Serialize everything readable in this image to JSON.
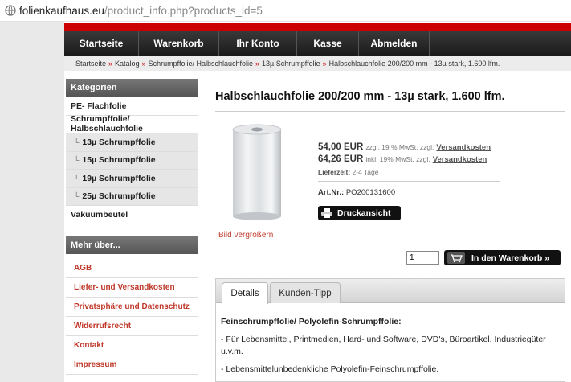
{
  "browser": {
    "url_host": "folienkaufhaus.eu",
    "url_path": "/product_info.php?products_id=5"
  },
  "nav": [
    "Startseite",
    "Warenkorb",
    "Ihr Konto",
    "Kasse",
    "Abmelden"
  ],
  "breadcrumb": [
    "Startseite",
    "Katalog",
    "Schrumpffolie/ Halbschlauchfolie",
    "13µ Schrumpffolie",
    "Halbschlauchfolie 200/200 mm - 13µ stark, 1.600 lfm."
  ],
  "sidebar": {
    "categories_title": "Kategorien",
    "categories": [
      {
        "label": "PE- Flachfolie",
        "sub": false
      },
      {
        "label": "Schrumpffolie/ Halbschlauchfolie",
        "sub": false
      },
      {
        "label": "13µ Schrumpffolie",
        "sub": true
      },
      {
        "label": "15µ Schrumpffolie",
        "sub": true
      },
      {
        "label": "19µ Schrumpffolie",
        "sub": true
      },
      {
        "label": "25µ Schrumpffolie",
        "sub": true
      },
      {
        "label": "Vakuumbeutel",
        "sub": false
      }
    ],
    "more_title": "Mehr über...",
    "more": [
      "AGB",
      "Liefer- und Versandkosten",
      "Privatsphäre und Datenschutz",
      "Widerrufsrecht",
      "Kontakt",
      "Impressum"
    ]
  },
  "product": {
    "title": "Halbschlauchfolie 200/200 mm - 13µ stark, 1.600 lfm.",
    "enlarge_label": "Bild vergrößern",
    "price_net": "54,00 EUR",
    "price_net_note": "zzgl. 19 % MwSt. zzgl.",
    "price_gross": "64,26 EUR",
    "price_gross_note": "inkl. 19% MwSt. zzgl.",
    "shipping_link": "Versandkosten",
    "delivery_label": "Lieferzeit:",
    "delivery_value": "2-4 Tage",
    "artnr_label": "Art.Nr.:",
    "artnr_value": "PO200131600",
    "print_label": "Druckansicht",
    "quantity": "1",
    "cart_label": "In den Warenkorb »"
  },
  "tabs": {
    "items": [
      "Details",
      "Kunden-Tipp"
    ],
    "heading": "Feinschrumpffolie/ Polyolefin-Schrumpffolie:",
    "para1": "- Für Lebensmittel, Printmedien, Hard- und Software, DVD's, Büroartikel, Industriegüter u.v.m.",
    "para2": "- Lebensmittelunbedenkliche Polyolefin-Feinschrumpffolie."
  },
  "colors": {
    "accent_red": "#cc0000",
    "link_red": "#c0392b",
    "nav_dark": "#1a1a1a"
  }
}
